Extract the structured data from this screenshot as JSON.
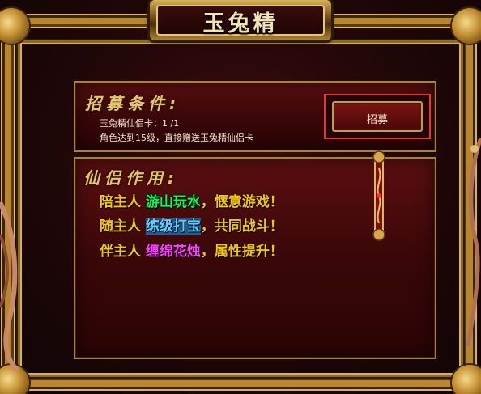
{
  "window": {
    "title": "玉兔精"
  },
  "recruit": {
    "heading": "招募条件:",
    "card_label": "玉兔精仙侣卡：",
    "card_count": "1 /1",
    "level_note": "角色达到15级，直接赠送玉兔精仙侣卡",
    "button_label": "招募",
    "button_highlight_color": "#e23b2a"
  },
  "effect": {
    "heading": "仙侣作用:",
    "lines": [
      {
        "prefix": "陪主人",
        "highlight": "游山玩水",
        "suffix": "，惬意游戏！",
        "highlight_color": "#00ff55"
      },
      {
        "prefix": "随主人",
        "highlight": "练级打宝",
        "suffix": "，共同战斗！",
        "highlight_color": "#5fd0ff"
      },
      {
        "prefix": "伴主人",
        "highlight": "缠绵花烛",
        "suffix": "，属性提升！",
        "highlight_color": "#ff40ff"
      }
    ]
  },
  "colors": {
    "frame_gold": "#b8862f",
    "panel_red": "#3a0708",
    "text_yellow": "#f5c800",
    "heading_gold": "#e8c46a"
  }
}
